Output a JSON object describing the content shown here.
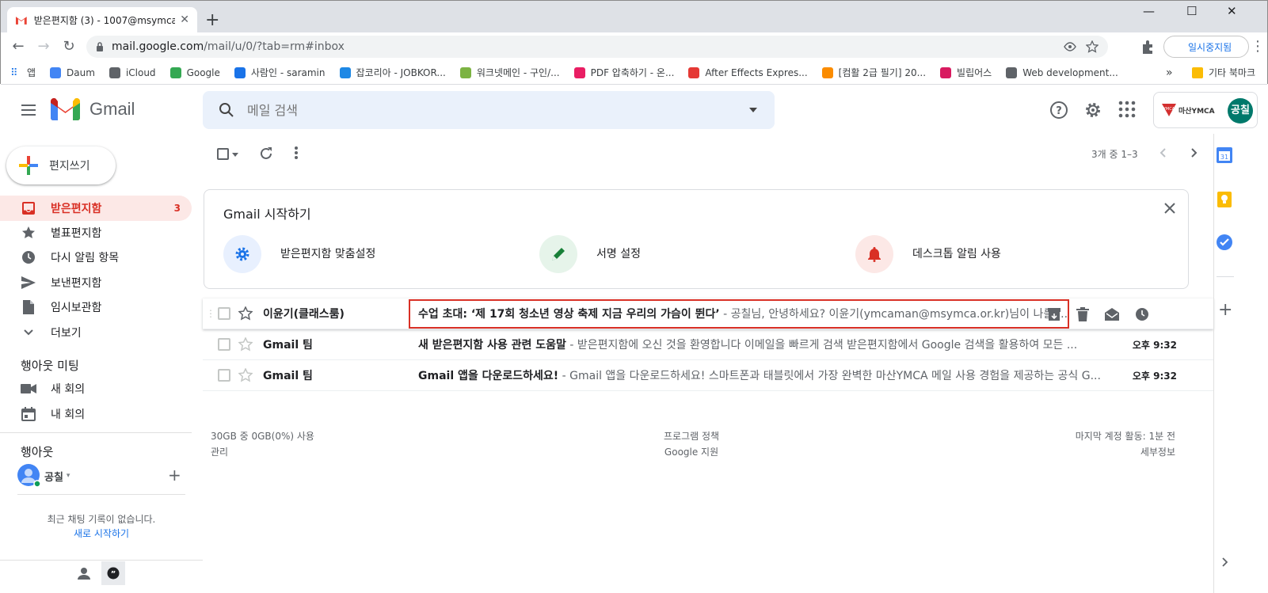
{
  "browser": {
    "tab_title": "받은편지함 (3) - 1007@msymca...",
    "tab_close": "✕",
    "new_tab": "+",
    "url_host": "mail.google.com",
    "url_path": "/mail/u/0/?tab=rm#inbox",
    "paused_label": "일시중지됨",
    "bookmarks": [
      {
        "label": "앱",
        "color": "#5f6368"
      },
      {
        "label": "Daum",
        "color": "#4285f4"
      },
      {
        "label": "iCloud",
        "color": "#5f6368"
      },
      {
        "label": "Google",
        "color": "#34a853"
      },
      {
        "label": "사람인 - saramin",
        "color": "#1a73e8"
      },
      {
        "label": "잡코리아 - JOBKOR...",
        "color": "#1e88e5"
      },
      {
        "label": "워크넷메인 - 구인/...",
        "color": "#7cb342"
      },
      {
        "label": "PDF 압축하기 - 온...",
        "color": "#e91e63"
      },
      {
        "label": "After Effects Expres...",
        "color": "#e53935"
      },
      {
        "label": "[컴활 2급 필기] 20...",
        "color": "#fb8c00"
      },
      {
        "label": "빌립어스",
        "color": "#d81b60"
      },
      {
        "label": "Web development...",
        "color": "#5f6368"
      }
    ],
    "bookmarks_more": "»",
    "other_bookmarks": "기타 북마크"
  },
  "gmail": {
    "product_name": "Gmail",
    "search_placeholder": "메일 검색",
    "account_avatar": "공칠",
    "account_org": "마산YMCA",
    "compose_label": "편지쓰기",
    "nav": [
      {
        "label": "받은편지함",
        "count": "3",
        "icon": "inbox-icon"
      },
      {
        "label": "별표편지함",
        "count": "",
        "icon": "star-icon"
      },
      {
        "label": "다시 알림 항목",
        "count": "",
        "icon": "clock-icon"
      },
      {
        "label": "보낸편지함",
        "count": "",
        "icon": "send-icon"
      },
      {
        "label": "임시보관함",
        "count": "",
        "icon": "draft-icon"
      },
      {
        "label": "더보기",
        "count": "",
        "icon": "chevron-down-icon"
      }
    ],
    "meet": {
      "heading": "행아웃 미팅",
      "items": [
        "새 회의",
        "내 회의"
      ]
    },
    "hangouts": {
      "heading": "행아웃",
      "user": "공칠",
      "empty_line1": "최근 채팅 기록이 없습니다.",
      "empty_link": "새로 시작하기"
    },
    "pagination": "3개 중 1–3",
    "getting_started": {
      "title": "Gmail 시작하기",
      "items": [
        {
          "label": "받은편지함 맞춤설정",
          "icon": "gear-icon",
          "color": "#1a73e8",
          "bg": "#e8f0fe"
        },
        {
          "label": "서명 설정",
          "icon": "pen-icon",
          "color": "#188038",
          "bg": "#e6f4ea"
        },
        {
          "label": "데스크톱 알림 사용",
          "icon": "bell-icon",
          "color": "#d93025",
          "bg": "#fce8e6"
        }
      ]
    },
    "emails": [
      {
        "sender": "이윤기(클래스룸)",
        "subject": "수업 초대: ‘제 17회 청소년 영상 축제 지금 우리의 가슴이 뛴다’",
        "snippet": " - 공칠님, 안녕하세요? 이윤기(ymcaman@msymca.or.kr)님이 나를 ...",
        "time": ""
      },
      {
        "sender": "Gmail 팀",
        "subject": "새 받은편지함 사용 관련 도움말",
        "snippet": " - 받은편지함에 오신 것을 환영합니다 이메일을 빠르게 검색 받은편지함에서 Google 검색을 활용하여 모든 ...",
        "time": "오후 9:32"
      },
      {
        "sender": "Gmail 팀",
        "subject": "Gmail 앱을 다운로드하세요!",
        "snippet": " - Gmail 앱을 다운로드하세요! 스마트폰과 태블릿에서 가장 완벽한 마산YMCA 메일 사용 경험을 제공하는 공식 G...",
        "time": "오후 9:32"
      }
    ],
    "footer": {
      "storage": "30GB 중 0GB(0%) 사용",
      "manage": "관리",
      "policy": "프로그램 정책",
      "support": "Google 지원",
      "activity": "마지막 계정 활동: 1분 전",
      "details": "세부정보"
    }
  }
}
